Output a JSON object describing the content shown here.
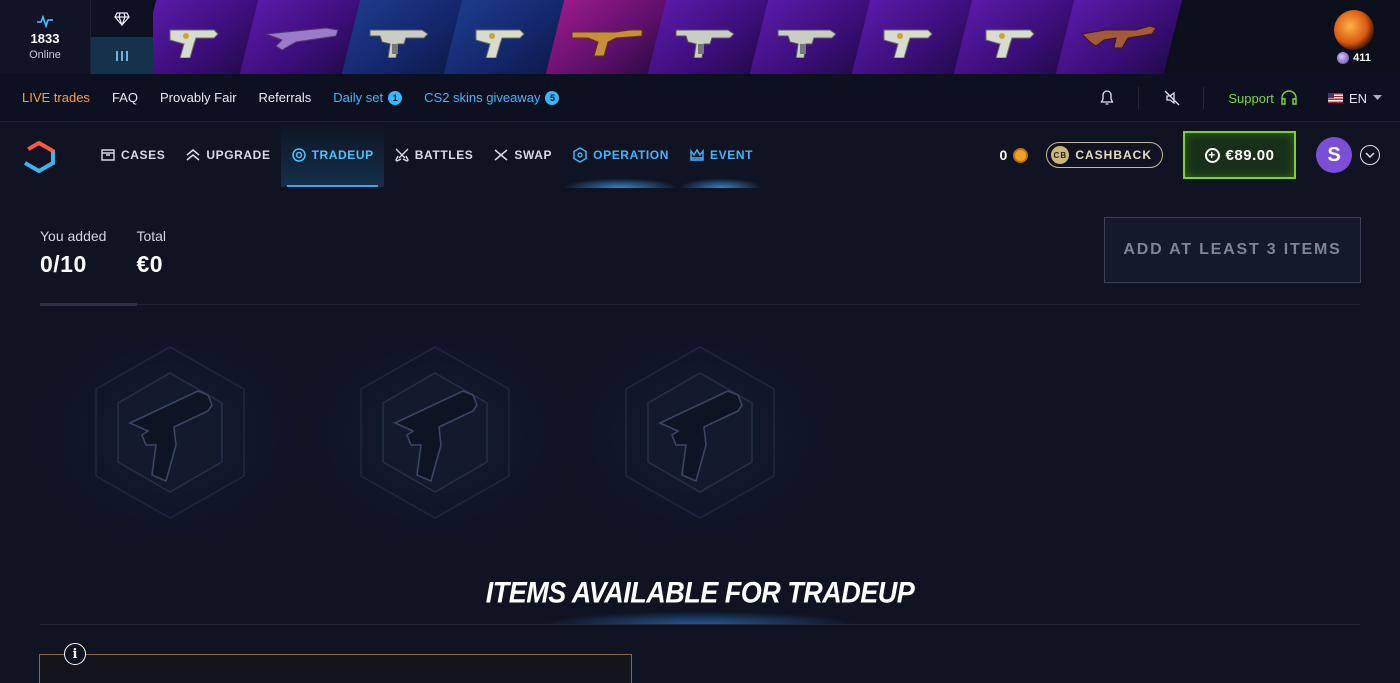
{
  "online": {
    "count": "1833",
    "label": "Online"
  },
  "live_drops": [
    {
      "weapon": "pistol",
      "theme": "purple"
    },
    {
      "weapon": "shotgun",
      "theme": "purple"
    },
    {
      "weapon": "smg",
      "theme": "blue"
    },
    {
      "weapon": "pistol",
      "theme": "blue"
    },
    {
      "weapon": "silenced-pistol",
      "theme": "pink"
    },
    {
      "weapon": "smg",
      "theme": "purple"
    },
    {
      "weapon": "smg",
      "theme": "purple"
    },
    {
      "weapon": "pistol",
      "theme": "purple"
    },
    {
      "weapon": "pistol",
      "theme": "purple"
    },
    {
      "weapon": "rifle",
      "theme": "purple"
    }
  ],
  "case_drop": {
    "count": "411"
  },
  "subnav": {
    "live_trades": "LIVE trades",
    "faq": "FAQ",
    "provably_fair": "Provably Fair",
    "referrals": "Referrals",
    "daily_set": "Daily set",
    "daily_set_badge": "1",
    "giveaway": "CS2 skins giveaway",
    "giveaway_badge": "5",
    "support": "Support",
    "language": "EN"
  },
  "nav": {
    "cases": "CASES",
    "upgrade": "UPGRADE",
    "tradeup": "TRADEUP",
    "battles": "BATTLES",
    "swap": "SWAP",
    "operation": "OPERATION",
    "event": "EVENT"
  },
  "account": {
    "coins": "0",
    "cashback": "CASHBACK",
    "cashback_icon": "CB",
    "balance": "€89.00",
    "avatar_letter": "S"
  },
  "tradeup": {
    "you_added_label": "You added",
    "you_added_value": "0/10",
    "total_label": "Total",
    "total_value": "€0",
    "add_button": "ADD AT LEAST 3 ITEMS"
  },
  "section_title": "ITEMS AVAILABLE FOR TRADEUP",
  "info_icon": "i",
  "colors": {
    "accent": "#3fb8ff",
    "live": "#ff9f2e",
    "support": "#7ddc2c",
    "balance_border": "#7ed321"
  }
}
